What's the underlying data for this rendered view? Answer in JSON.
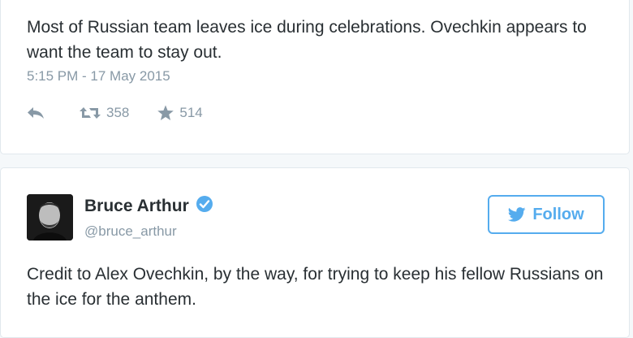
{
  "tweets": [
    {
      "text": "Most of Russian team leaves ice during celebrations.  Ovechkin appears to want the team to stay out.",
      "timestamp": "5:15 PM - 17 May 2015",
      "retweets": "358",
      "favorites": "514"
    },
    {
      "author": {
        "name": "Bruce Arthur",
        "handle": "@bruce_arthur",
        "verified": true
      },
      "follow_label": "Follow",
      "text": "Credit to Alex Ovechkin, by the way, for trying to keep his fellow Russians on the ice for the anthem."
    }
  ],
  "icons": {
    "reply": "reply-icon",
    "retweet": "retweet-icon",
    "favorite": "star-icon",
    "verified": "verified-badge-icon",
    "follow": "twitter-bird-icon"
  },
  "colors": {
    "accent": "#55acee",
    "text": "#292f33",
    "muted": "#8899a6",
    "border": "#e1e8ed"
  }
}
